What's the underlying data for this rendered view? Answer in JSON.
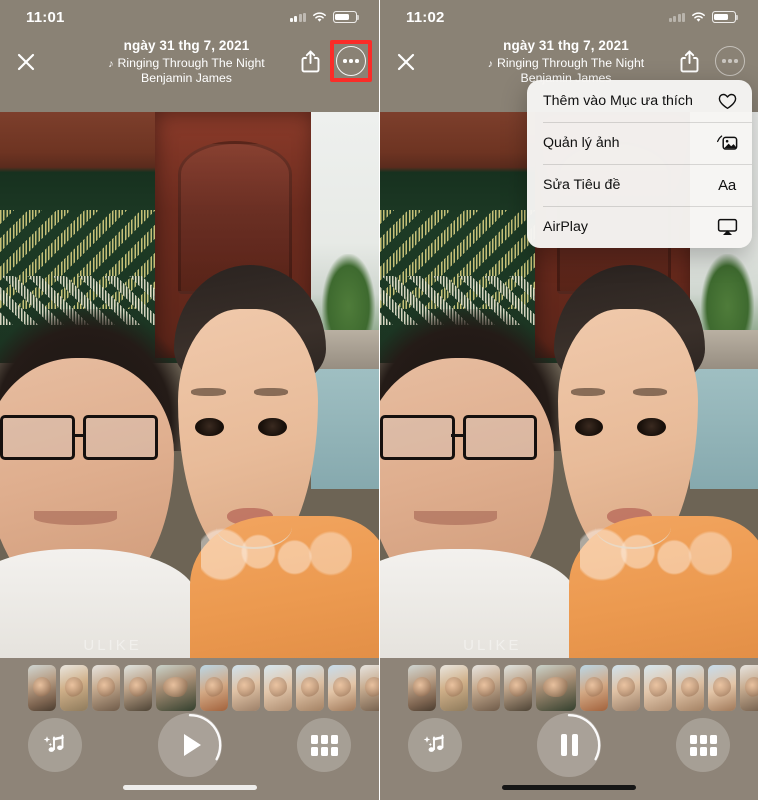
{
  "screens": [
    {
      "id": "left",
      "statusbar": {
        "time": "11:01",
        "signal_icon": "cellular-signal-icon",
        "wifi_icon": "wifi-icon",
        "battery_icon": "battery-icon"
      },
      "header": {
        "close_icon": "close-icon",
        "date": "ngày 31 thg 7, 2021",
        "song_note_icon": "music-note-icon",
        "song": "Ringing Through The Night",
        "artist": "Benjamin James",
        "share_icon": "share-icon",
        "more_icon": "more-options-icon"
      },
      "photo": {
        "watermark": "ULIKE"
      },
      "bottom": {
        "music_icon": "music-sparkle-icon",
        "play_icon": "play-icon",
        "grid_icon": "grid-icon",
        "playing": false
      },
      "highlight": {
        "target": "more-options-button",
        "color": "#fb2c28"
      },
      "menu_open": false
    },
    {
      "id": "right",
      "statusbar": {
        "time": "11:02",
        "signal_icon": "cellular-signal-icon",
        "wifi_icon": "wifi-icon",
        "battery_icon": "battery-icon"
      },
      "header": {
        "close_icon": "close-icon",
        "date": "ngày 31 thg 7, 2021",
        "song_note_icon": "music-note-icon",
        "song": "Ringing Through The Night",
        "artist": "Benjamin James",
        "share_icon": "share-icon",
        "more_icon": "more-options-icon"
      },
      "photo": {
        "watermark": "ULIKE"
      },
      "bottom": {
        "music_icon": "music-sparkle-icon",
        "play_icon": "pause-icon",
        "grid_icon": "grid-icon",
        "playing": true
      },
      "highlight": {
        "target": "menu-item-manage-photos",
        "color": "#fb2c28"
      },
      "menu_open": true
    }
  ],
  "context_menu": {
    "items": [
      {
        "label": "Thêm vào Mục ưa thích",
        "icon": "heart-icon"
      },
      {
        "label": "Quản lý ảnh",
        "icon": "photos-stack-icon"
      },
      {
        "label": "Sửa Tiêu đề",
        "icon": "text-format-aa-icon"
      },
      {
        "label": "AirPlay",
        "icon": "airplay-icon"
      }
    ]
  },
  "colors": {
    "highlight": "#fb2c28",
    "menu_bg": "#f6f5f3",
    "bar_bg": "#8e8478"
  }
}
